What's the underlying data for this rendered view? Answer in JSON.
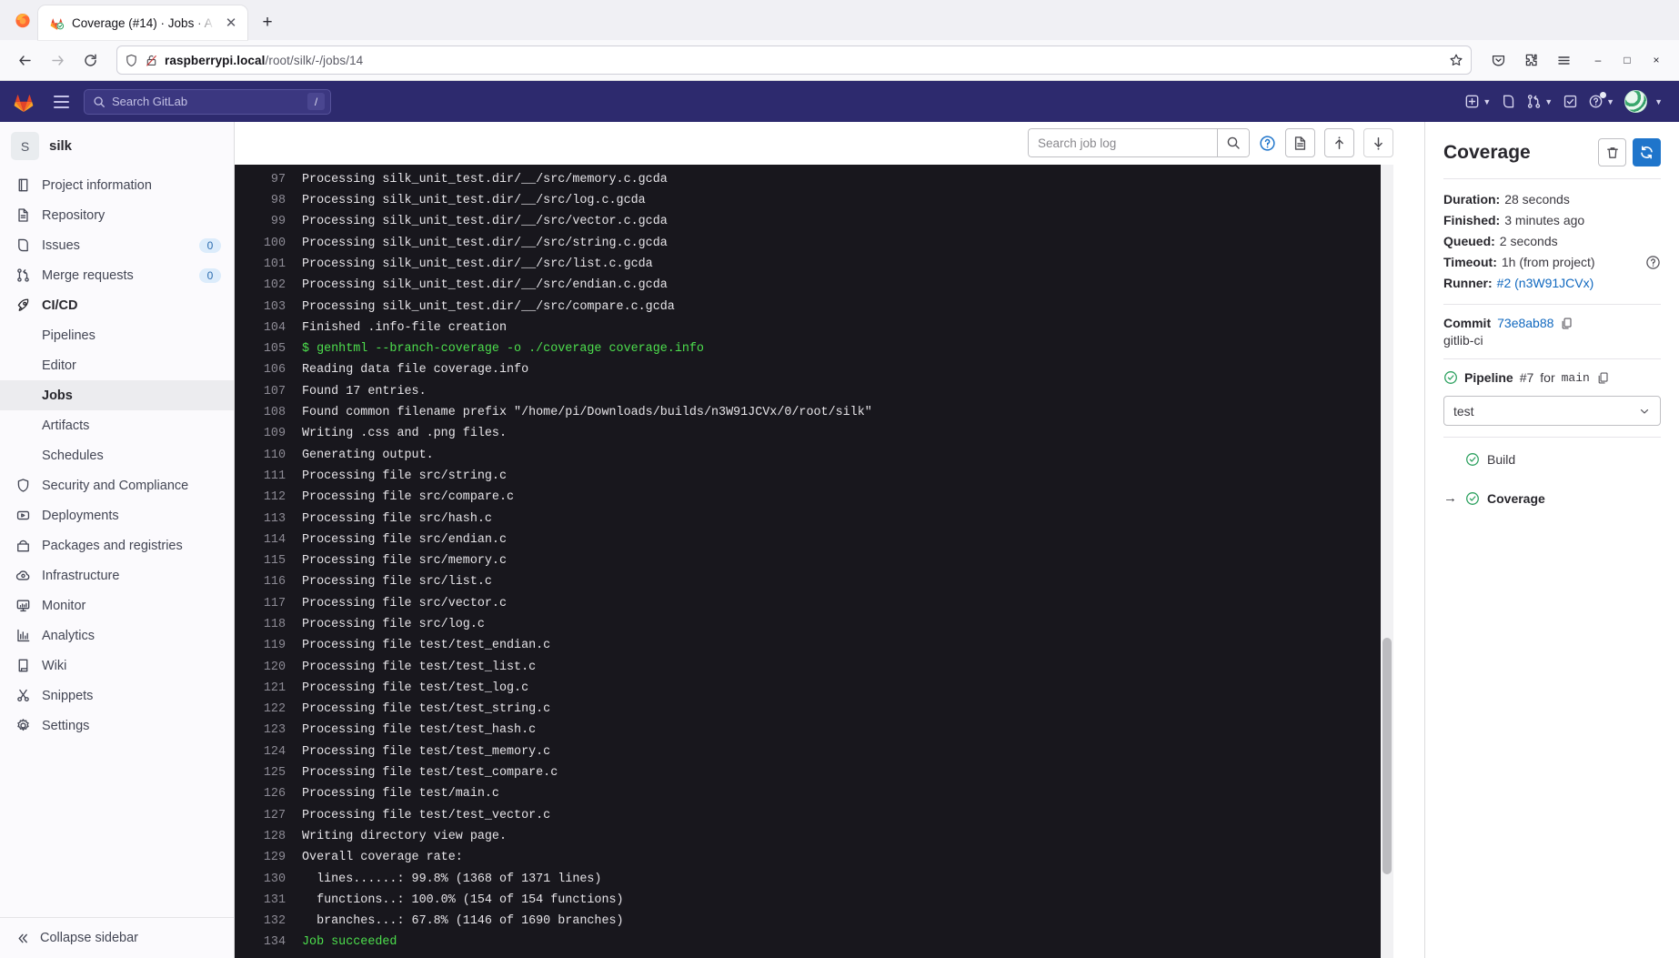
{
  "browser": {
    "tab_title": "Coverage (#14) · Jobs · A",
    "tab_favicon_icon": "gitlab-favicon-icon",
    "close_icon": "close-icon",
    "newtab_label": "+",
    "back_icon": "back-arrow-icon",
    "forward_icon": "forward-arrow-icon",
    "reload_icon": "reload-icon",
    "shield_icon": "shield-icon",
    "lock_broken_icon": "lock-broken-icon",
    "url_host": "raspberrypi.local",
    "url_path": "/root/silk/-/jobs/14",
    "bookmark_icon": "star-icon",
    "pocket_icon": "pocket-icon",
    "extensions_icon": "extensions-icon",
    "appmenu_icon": "hamburger-menu-icon",
    "minimize_label": "–",
    "maximize_label": "□",
    "close_label": "×"
  },
  "gitlab_topbar": {
    "brand_icon": "gitlab-logo-icon",
    "menu_icon": "hamburger-menu-icon",
    "search_placeholder": "Search GitLab",
    "search_shortcut": "/",
    "search_icon": "search-icon",
    "icons": [
      {
        "name": "create-new-icon",
        "caret": true
      },
      {
        "name": "issues-icon",
        "caret": false
      },
      {
        "name": "merge-requests-icon",
        "caret": true
      },
      {
        "name": "todos-icon",
        "caret": false
      },
      {
        "name": "help-icon",
        "caret": true
      }
    ],
    "avatar_name": "user-avatar"
  },
  "sidebar": {
    "project_initial": "S",
    "project_name": "silk",
    "items": [
      {
        "label": "Project information",
        "icon": "book-icon",
        "badge": null,
        "state": "normal"
      },
      {
        "label": "Repository",
        "icon": "doc-icon",
        "badge": null,
        "state": "normal"
      },
      {
        "label": "Issues",
        "icon": "issues-icon",
        "badge": "0",
        "state": "normal"
      },
      {
        "label": "Merge requests",
        "icon": "merge-request-icon",
        "badge": "0",
        "state": "normal"
      },
      {
        "label": "CI/CD",
        "icon": "rocket-icon",
        "badge": null,
        "state": "bold"
      },
      {
        "label": "Pipelines",
        "icon": null,
        "badge": null,
        "state": "sub"
      },
      {
        "label": "Editor",
        "icon": null,
        "badge": null,
        "state": "sub"
      },
      {
        "label": "Jobs",
        "icon": null,
        "badge": null,
        "state": "sub-active"
      },
      {
        "label": "Artifacts",
        "icon": null,
        "badge": null,
        "state": "sub"
      },
      {
        "label": "Schedules",
        "icon": null,
        "badge": null,
        "state": "sub"
      },
      {
        "label": "Security and Compliance",
        "icon": "shield-icon",
        "badge": null,
        "state": "normal"
      },
      {
        "label": "Deployments",
        "icon": "deployments-icon",
        "badge": null,
        "state": "normal"
      },
      {
        "label": "Packages and registries",
        "icon": "package-icon",
        "badge": null,
        "state": "normal"
      },
      {
        "label": "Infrastructure",
        "icon": "cloud-icon",
        "badge": null,
        "state": "normal"
      },
      {
        "label": "Monitor",
        "icon": "monitor-icon",
        "badge": null,
        "state": "normal"
      },
      {
        "label": "Analytics",
        "icon": "chart-icon",
        "badge": null,
        "state": "normal"
      },
      {
        "label": "Wiki",
        "icon": "book-open-icon",
        "badge": null,
        "state": "normal"
      },
      {
        "label": "Snippets",
        "icon": "scissors-icon",
        "badge": null,
        "state": "normal"
      },
      {
        "label": "Settings",
        "icon": "gear-icon",
        "badge": null,
        "state": "normal"
      }
    ],
    "collapse_label": "Collapse sidebar",
    "collapse_icon": "chevron-double-left-icon"
  },
  "log_toolbar": {
    "search_placeholder": "Search job log",
    "search_icon": "search-icon",
    "help_icon": "question-circle-icon",
    "raw_icon": "document-icon",
    "scroll_top_icon": "scroll-to-top-icon",
    "scroll_bottom_icon": "scroll-to-bottom-icon"
  },
  "job_log": {
    "lines": [
      {
        "n": "97",
        "text": "Processing silk_unit_test.dir/__/src/memory.c.gcda",
        "style": "normal"
      },
      {
        "n": "98",
        "text": "Processing silk_unit_test.dir/__/src/log.c.gcda",
        "style": "normal"
      },
      {
        "n": "99",
        "text": "Processing silk_unit_test.dir/__/src/vector.c.gcda",
        "style": "normal"
      },
      {
        "n": "100",
        "text": "Processing silk_unit_test.dir/__/src/string.c.gcda",
        "style": "normal"
      },
      {
        "n": "101",
        "text": "Processing silk_unit_test.dir/__/src/list.c.gcda",
        "style": "normal"
      },
      {
        "n": "102",
        "text": "Processing silk_unit_test.dir/__/src/endian.c.gcda",
        "style": "normal"
      },
      {
        "n": "103",
        "text": "Processing silk_unit_test.dir/__/src/compare.c.gcda",
        "style": "normal"
      },
      {
        "n": "104",
        "text": "Finished .info-file creation",
        "style": "normal"
      },
      {
        "n": "105",
        "text": "$ genhtml --branch-coverage -o ./coverage coverage.info",
        "style": "green"
      },
      {
        "n": "106",
        "text": "Reading data file coverage.info",
        "style": "normal"
      },
      {
        "n": "107",
        "text": "Found 17 entries.",
        "style": "normal"
      },
      {
        "n": "108",
        "text": "Found common filename prefix \"/home/pi/Downloads/builds/n3W91JCVx/0/root/silk\"",
        "style": "normal"
      },
      {
        "n": "109",
        "text": "Writing .css and .png files.",
        "style": "normal"
      },
      {
        "n": "110",
        "text": "Generating output.",
        "style": "normal"
      },
      {
        "n": "111",
        "text": "Processing file src/string.c",
        "style": "normal"
      },
      {
        "n": "112",
        "text": "Processing file src/compare.c",
        "style": "normal"
      },
      {
        "n": "113",
        "text": "Processing file src/hash.c",
        "style": "normal"
      },
      {
        "n": "114",
        "text": "Processing file src/endian.c",
        "style": "normal"
      },
      {
        "n": "115",
        "text": "Processing file src/memory.c",
        "style": "normal"
      },
      {
        "n": "116",
        "text": "Processing file src/list.c",
        "style": "normal"
      },
      {
        "n": "117",
        "text": "Processing file src/vector.c",
        "style": "normal"
      },
      {
        "n": "118",
        "text": "Processing file src/log.c",
        "style": "normal"
      },
      {
        "n": "119",
        "text": "Processing file test/test_endian.c",
        "style": "normal"
      },
      {
        "n": "120",
        "text": "Processing file test/test_list.c",
        "style": "normal"
      },
      {
        "n": "121",
        "text": "Processing file test/test_log.c",
        "style": "normal"
      },
      {
        "n": "122",
        "text": "Processing file test/test_string.c",
        "style": "normal"
      },
      {
        "n": "123",
        "text": "Processing file test/test_hash.c",
        "style": "normal"
      },
      {
        "n": "124",
        "text": "Processing file test/test_memory.c",
        "style": "normal"
      },
      {
        "n": "125",
        "text": "Processing file test/test_compare.c",
        "style": "normal"
      },
      {
        "n": "126",
        "text": "Processing file test/main.c",
        "style": "normal"
      },
      {
        "n": "127",
        "text": "Processing file test/test_vector.c",
        "style": "normal"
      },
      {
        "n": "128",
        "text": "Writing directory view page.",
        "style": "normal"
      },
      {
        "n": "129",
        "text": "Overall coverage rate:",
        "style": "normal"
      },
      {
        "n": "130",
        "text": "  lines......: 99.8% (1368 of 1371 lines)",
        "style": "normal"
      },
      {
        "n": "131",
        "text": "  functions..: 100.0% (154 of 154 functions)",
        "style": "normal"
      },
      {
        "n": "132",
        "text": "  branches...: 67.8% (1146 of 1690 branches)",
        "style": "normal"
      },
      {
        "n": "134",
        "text": "Job succeeded",
        "style": "green"
      }
    ]
  },
  "right_panel": {
    "title": "Coverage",
    "erase_icon": "trash-icon",
    "retry_icon": "retry-icon",
    "details": [
      {
        "label": "Duration:",
        "value": "28 seconds",
        "help": false
      },
      {
        "label": "Finished:",
        "value": "3 minutes ago",
        "help": false
      },
      {
        "label": "Queued:",
        "value": "2 seconds",
        "help": false
      },
      {
        "label": "Timeout:",
        "value": "1h (from project)",
        "help": true
      },
      {
        "label": "Runner:",
        "value": "#2 (n3W91JCVx)",
        "help": false,
        "link": true
      }
    ],
    "help_icon": "question-circle-icon",
    "commit_label": "Commit",
    "commit_sha": "73e8ab88",
    "commit_copy_icon": "copy-icon",
    "commit_message": "gitlib-ci",
    "pipeline_status_icon": "status-success-icon",
    "pipeline_label": "Pipeline",
    "pipeline_number": "#7",
    "pipeline_for": "for",
    "pipeline_ref": "main",
    "pipeline_copy_icon": "copy-icon",
    "stage_select_value": "test",
    "stage_select_caret": "chevron-down-icon",
    "jobs": [
      {
        "name": "Build",
        "status_icon": "status-success-icon",
        "current": false,
        "arrow": ""
      },
      {
        "name": "Coverage",
        "status_icon": "status-success-icon",
        "current": true,
        "arrow": "→"
      }
    ]
  }
}
